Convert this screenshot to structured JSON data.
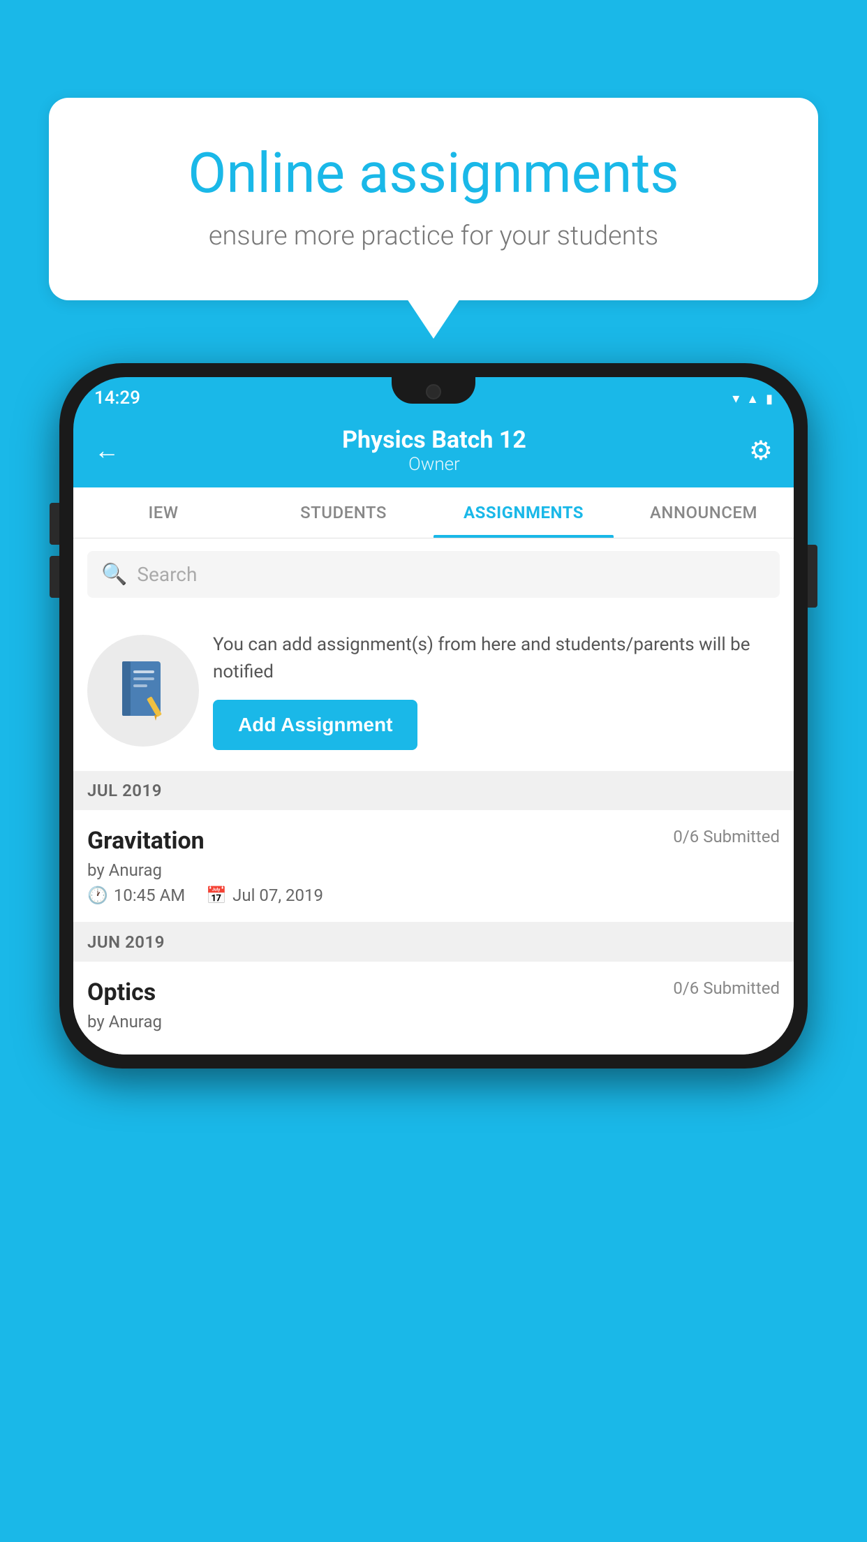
{
  "background_color": "#1ab8e8",
  "speech_bubble": {
    "title": "Online assignments",
    "subtitle": "ensure more practice for your students"
  },
  "phone": {
    "status_bar": {
      "time": "14:29",
      "icons": [
        "wifi",
        "signal",
        "battery"
      ]
    },
    "header": {
      "title": "Physics Batch 12",
      "subtitle": "Owner",
      "back_label": "←",
      "gear_label": "⚙"
    },
    "tabs": [
      {
        "label": "IEW",
        "active": false
      },
      {
        "label": "STUDENTS",
        "active": false
      },
      {
        "label": "ASSIGNMENTS",
        "active": true
      },
      {
        "label": "ANNOUNCEM",
        "active": false
      }
    ],
    "search": {
      "placeholder": "Search"
    },
    "promo": {
      "description": "You can add assignment(s) from here and students/parents will be notified",
      "button_label": "Add Assignment"
    },
    "sections": [
      {
        "month": "JUL 2019",
        "assignments": [
          {
            "name": "Gravitation",
            "submitted": "0/6 Submitted",
            "author": "by Anurag",
            "time": "10:45 AM",
            "date": "Jul 07, 2019"
          }
        ]
      },
      {
        "month": "JUN 2019",
        "assignments": [
          {
            "name": "Optics",
            "submitted": "0/6 Submitted",
            "author": "by Anurag",
            "time": "",
            "date": ""
          }
        ]
      }
    ]
  }
}
